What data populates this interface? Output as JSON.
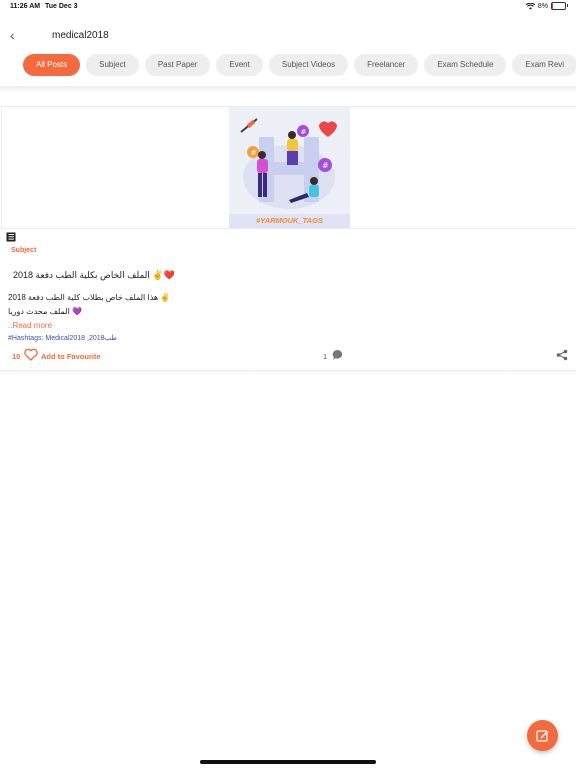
{
  "status_bar": {
    "time": "11:26 AM",
    "date": "Tue Dec 3",
    "battery": "8%",
    "battery_level": 0.08,
    "icons": [
      "wifi-icon",
      "battery-icon"
    ]
  },
  "header": {
    "back_icon": "chevron-left-icon",
    "title": "medical2018"
  },
  "tabs": [
    {
      "label": "All Posts",
      "active": true
    },
    {
      "label": "Subject"
    },
    {
      "label": "Past Paper"
    },
    {
      "label": "Event"
    },
    {
      "label": "Subject Videos"
    },
    {
      "label": "Freelancer"
    },
    {
      "label": "Exam Schedule"
    },
    {
      "label": "Exam Revi"
    }
  ],
  "post": {
    "image_caption": "#YARMOUK_TAGS",
    "category": "Subject",
    "title": "الملف الخاص بكلية الطب دفعة 2018 ✌️❤️",
    "lines": [
      "هذا الملف خاص بطلاب كلية الطب دفعة 2018 ✌️",
      "الملف محدث دوريا 💜"
    ],
    "read_more": "..Read more",
    "hashtags_label": "#Hashtags:",
    "hashtags": "Medical2018 ,طب2018",
    "likes": "10",
    "favourite_label": "Add to Favourite",
    "comments": "1"
  },
  "colors": {
    "accent": "#f26a3d",
    "link": "#3f4fb0",
    "tab_bg": "#eeeeee"
  },
  "fab": {
    "icon": "edit-icon"
  }
}
